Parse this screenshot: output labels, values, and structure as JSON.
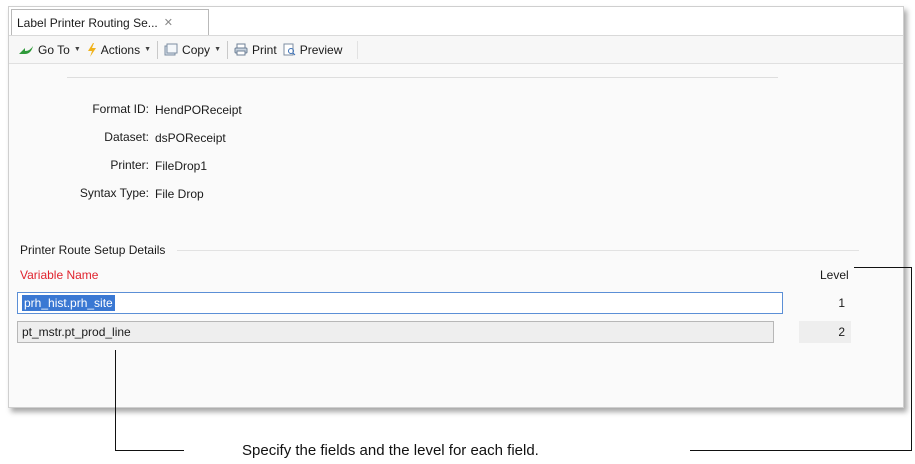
{
  "tab": {
    "title": "Label Printer Routing Se...",
    "close": "✕"
  },
  "toolbar": {
    "goto": "Go To",
    "actions": "Actions",
    "copy": "Copy",
    "print": "Print",
    "preview": "Preview"
  },
  "form": {
    "format_id_label": "Format ID:",
    "format_id_value": "HendPOReceipt",
    "dataset_label": "Dataset:",
    "dataset_value": "dsPOReceipt",
    "printer_label": "Printer:",
    "printer_value": "FileDrop1",
    "syntax_label": "Syntax Type:",
    "syntax_value": "File Drop"
  },
  "section": {
    "title": "Printer Route Setup Details",
    "col_variable": "Variable Name",
    "col_level": "Level",
    "rows": [
      {
        "variable": "prh_hist.prh_site",
        "level": "1"
      },
      {
        "variable": "pt_mstr.pt_prod_line",
        "level": "2"
      }
    ]
  },
  "callout": {
    "text": "Specify the fields and the level for each field."
  },
  "colors": {
    "variable_header": "#e0232e",
    "selection": "#3a78d3",
    "focus_border": "#5b8fd6"
  }
}
